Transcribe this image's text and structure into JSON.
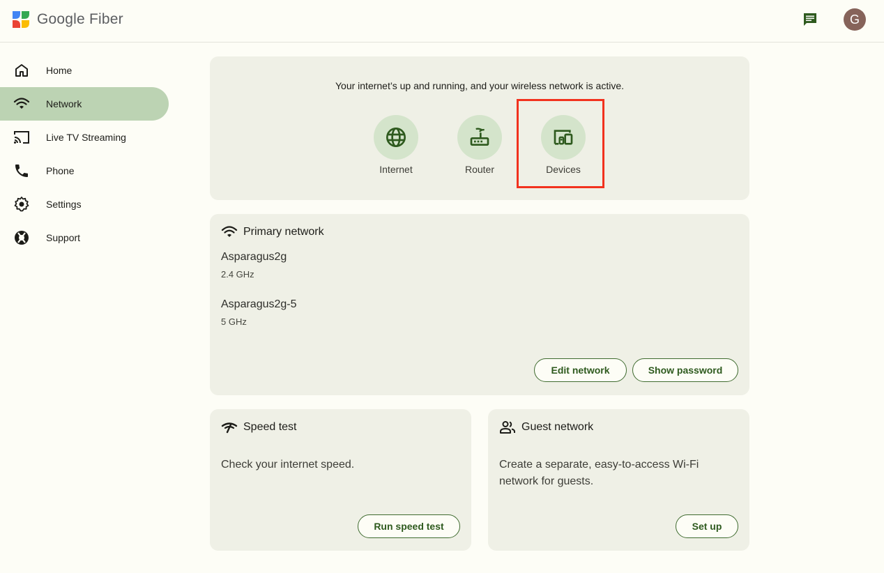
{
  "header": {
    "brand": "Google Fiber",
    "avatar_initial": "G",
    "icons": {
      "logo": "google-fiber-logo",
      "chat": "chat-icon"
    }
  },
  "sidebar": {
    "items": [
      {
        "label": "Home",
        "icon": "home-icon",
        "active": false
      },
      {
        "label": "Network",
        "icon": "wifi-icon",
        "active": true
      },
      {
        "label": "Live TV Streaming",
        "icon": "cast-icon",
        "active": false
      },
      {
        "label": "Phone",
        "icon": "phone-icon",
        "active": false
      },
      {
        "label": "Settings",
        "icon": "gear-icon",
        "active": false
      },
      {
        "label": "Support",
        "icon": "support-icon",
        "active": false
      }
    ]
  },
  "status": {
    "message": "Your internet’s up and running, and your wireless network is active.",
    "items": [
      {
        "label": "Internet",
        "icon": "globe-icon"
      },
      {
        "label": "Router",
        "icon": "router-icon"
      },
      {
        "label": "Devices",
        "icon": "devices-icon",
        "highlighted": true
      }
    ]
  },
  "primary_network": {
    "title": "Primary network",
    "networks": [
      {
        "ssid": "Asparagus2g",
        "band": "2.4 GHz"
      },
      {
        "ssid": "Asparagus2g-5",
        "band": "5 GHz"
      }
    ],
    "buttons": {
      "edit": "Edit network",
      "show_password": "Show password"
    }
  },
  "speed_test": {
    "title": "Speed test",
    "description": "Check your internet speed.",
    "button": "Run speed test"
  },
  "guest_network": {
    "title": "Guest network",
    "description": "Create a separate, easy-to-access Wi-Fi network for guests.",
    "button": "Set up"
  },
  "colors": {
    "accent": "#3f6b2f",
    "active_nav": "#bcd3b3",
    "card_bg": "#eff0e6",
    "icon_circle": "#d4e4cb",
    "highlight": "#f2321e",
    "avatar": "#86635a"
  }
}
